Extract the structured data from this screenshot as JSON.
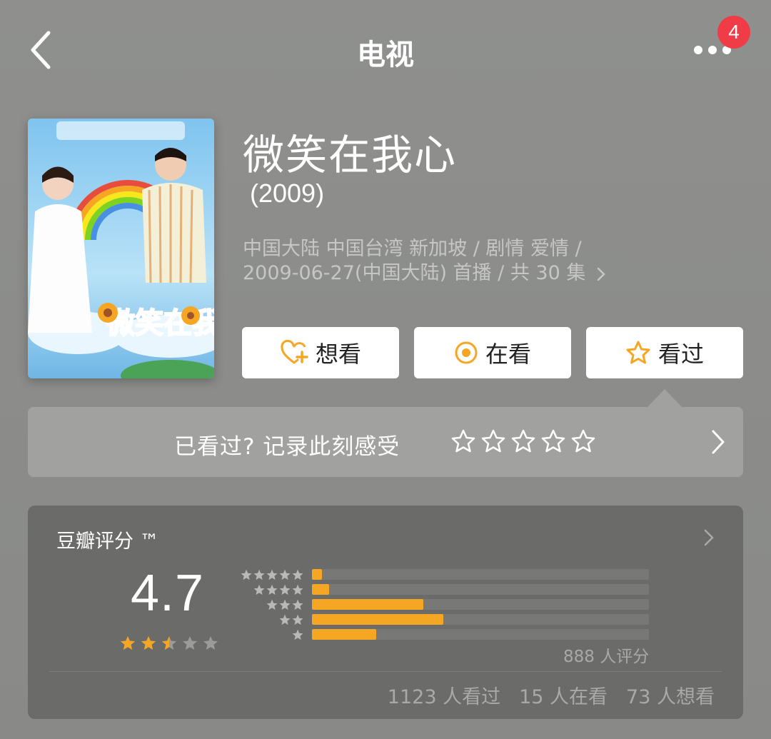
{
  "header": {
    "title": "电视",
    "notification_count": "4"
  },
  "show": {
    "title": "微笑在我心",
    "year": "(2009)",
    "meta_line1": "中国大陆 中国台湾 新加坡 / 剧情 爱情 /",
    "meta_line2": "2009-06-27(中国大陆) 首播 / 共 30 集",
    "poster_title_art": "微笑在我心"
  },
  "actions": {
    "want_label": "想看",
    "watching_label": "在看",
    "watched_label": "看过"
  },
  "record": {
    "label": "已看过? 记录此刻感受"
  },
  "rating": {
    "title": "豆瓣评分 ™",
    "score": "4.7",
    "score_stars": 2.5,
    "distribution": [
      {
        "stars": 5,
        "fraction": 0.03
      },
      {
        "stars": 4,
        "fraction": 0.05
      },
      {
        "stars": 3,
        "fraction": 0.33
      },
      {
        "stars": 2,
        "fraction": 0.39
      },
      {
        "stars": 1,
        "fraction": 0.19
      }
    ],
    "raters": "888 人评分",
    "watched_count": "1123 人看过",
    "watching_count": "15 人在看",
    "want_count": "73 人想看"
  },
  "colors": {
    "accent": "#f5a623",
    "badge": "#ef3c47",
    "star_empty": "#9b9b99"
  }
}
